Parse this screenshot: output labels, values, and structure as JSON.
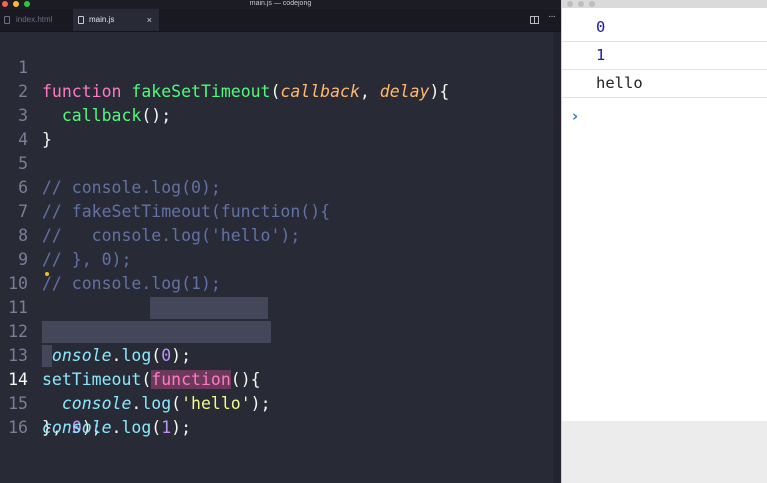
{
  "window": {
    "title": "main.js — codejong"
  },
  "tabs": [
    {
      "label": "index.html"
    },
    {
      "label": "main.js",
      "close": "×"
    }
  ],
  "editor": {
    "line_numbers": [
      "1",
      "2",
      "3",
      "4",
      "5",
      "6",
      "7",
      "8",
      "9",
      "10",
      "11",
      "12",
      "13",
      "14",
      "15",
      "16"
    ],
    "active_line": "14",
    "code": {
      "l1": {
        "kw": "function",
        "name": "fakeSetTimeout",
        "open": "(",
        "p1": "callback",
        "comma": ", ",
        "p2": "delay",
        "close": "){"
      },
      "l2": {
        "indent": "  ",
        "call": "callback",
        "rest": "();"
      },
      "l3": "}",
      "l5": "// console.log(0);",
      "l6": "// fakeSetTimeout(function(){",
      "l7": "//   console.log('hello');",
      "l8": "// }, 0);",
      "l9": "// console.log(1);",
      "l11": {
        "obj": "console",
        "dot": ".",
        "method": "log",
        "open": "(",
        "num": "0",
        "close": ");"
      },
      "l12": {
        "name": "setTimeout",
        "open": "(",
        "kw": "function",
        "rest": "(){"
      },
      "l13": {
        "indent": "  ",
        "obj": "console",
        "dot": ".",
        "method": "log",
        "open": "(",
        "str": "'hello'",
        "close": ");"
      },
      "l14": {
        "brace": "}",
        "comma": ", ",
        "num": "0",
        "close": ");"
      },
      "l15": {
        "obj": "console",
        "dot": ".",
        "method": "log",
        "open": "(",
        "num": "1",
        "close": ");"
      }
    }
  },
  "console": {
    "entries": [
      {
        "text": "0",
        "type": "number"
      },
      {
        "text": "1",
        "type": "number"
      },
      {
        "text": "hello",
        "type": "string"
      }
    ],
    "prompt": "›"
  },
  "colors": {
    "editor_bg": "#282a36",
    "keyword": "#8be9fd",
    "pink": "#ff79c6",
    "function": "#50fa7b",
    "param": "#ffb86c",
    "number": "#bd93f9",
    "string": "#f1fa8c",
    "comment": "#6272a4"
  }
}
